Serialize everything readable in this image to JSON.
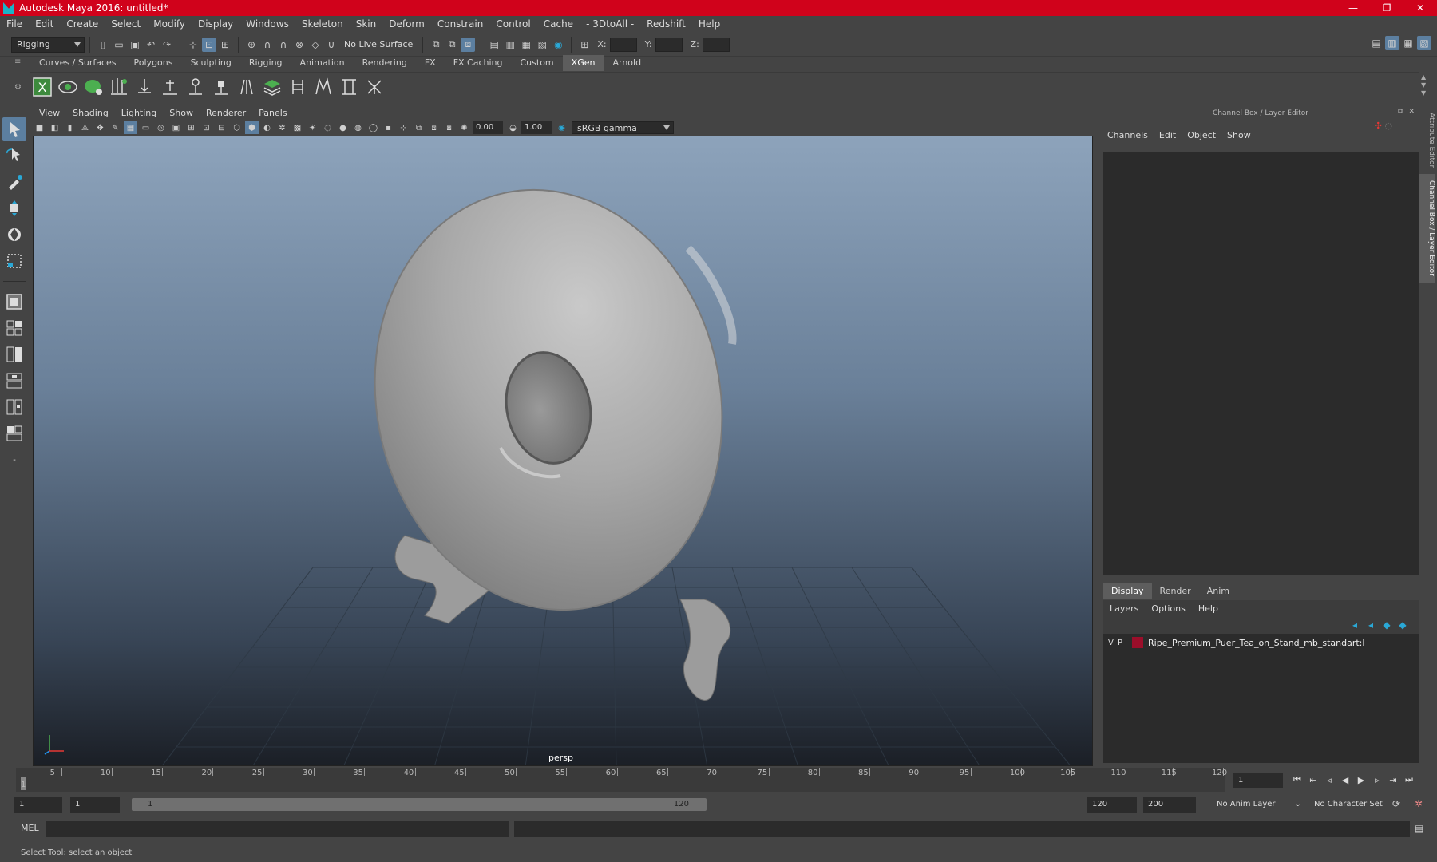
{
  "window": {
    "title": "Autodesk Maya 2016: untitled*",
    "min": "—",
    "max": "❐",
    "close": "✕"
  },
  "menubar": [
    "File",
    "Edit",
    "Create",
    "Select",
    "Modify",
    "Display",
    "Windows",
    "Skeleton",
    "Skin",
    "Deform",
    "Constrain",
    "Control",
    "Cache",
    "- 3DtoAll -",
    "Redshift",
    "Help"
  ],
  "statusline": {
    "mode": "Rigging",
    "live_surface": "No Live Surface",
    "x_label": "X:",
    "y_label": "Y:",
    "z_label": "Z:"
  },
  "shelf": {
    "tabs": [
      "Curves / Surfaces",
      "Polygons",
      "Sculpting",
      "Rigging",
      "Animation",
      "Rendering",
      "FX",
      "FX Caching",
      "Custom",
      "XGen",
      "Arnold"
    ],
    "active": "XGen"
  },
  "viewport": {
    "menu": [
      "View",
      "Shading",
      "Lighting",
      "Show",
      "Renderer",
      "Panels"
    ],
    "exposure": "0.00",
    "gamma": "1.00",
    "color_space": "sRGB gamma",
    "camera": "persp"
  },
  "right_panel": {
    "header": "Channel Box / Layer Editor",
    "menu": [
      "Channels",
      "Edit",
      "Object",
      "Show"
    ],
    "layer_tabs": [
      "Display",
      "Render",
      "Anim"
    ],
    "layer_menu": [
      "Layers",
      "Options",
      "Help"
    ],
    "layer": {
      "v": "V",
      "p": "P",
      "name": "Ripe_Premium_Puer_Tea_on_Stand_mb_standart:Ripe_Pre",
      "color": "#9b0e2a"
    },
    "side_tabs": [
      "Attribute Editor",
      "Channel Box / Layer Editor"
    ]
  },
  "timeline": {
    "ticks": [
      5,
      10,
      15,
      20,
      25,
      30,
      35,
      40,
      45,
      50,
      55,
      60,
      65,
      70,
      75,
      80,
      85,
      90,
      95,
      100,
      105,
      110,
      115,
      120
    ],
    "start_label": "1",
    "current_frame": "1"
  },
  "range": {
    "start": "1",
    "anim_start": "1",
    "range_start": "1",
    "range_end": "120",
    "end": "120",
    "anim_end": "200",
    "anim_layer": "No Anim Layer",
    "char_set": "No Character Set"
  },
  "command": {
    "label": "MEL"
  },
  "helpline": "Select Tool: select an object"
}
